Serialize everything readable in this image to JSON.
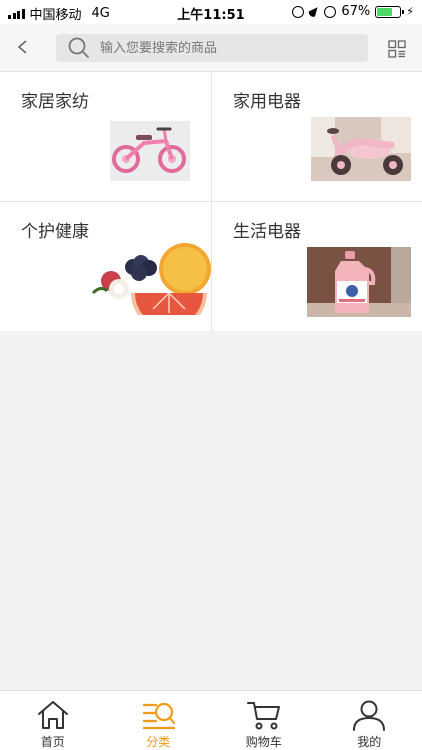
{
  "status_bar": {
    "carrier": "中国移动",
    "network": "4G",
    "time": "上午11:51",
    "battery": "67%",
    "battery_level": 0.67
  },
  "search": {
    "placeholder": "输入您要搜索的商品"
  },
  "categories": [
    {
      "title": "家居家纺",
      "icon": "pink-balance-bike"
    },
    {
      "title": "家用电器",
      "icon": "pink-tricycle"
    },
    {
      "title": "个护健康",
      "icon": "fruits-grapefruit-lychee"
    },
    {
      "title": "生活电器",
      "icon": "pink-detergent-bottle"
    }
  ],
  "tabs": [
    {
      "label": "首页",
      "icon": "home-icon",
      "active": false
    },
    {
      "label": "分类",
      "icon": "category-icon",
      "active": true
    },
    {
      "label": "购物车",
      "icon": "cart-icon",
      "active": false
    },
    {
      "label": "我的",
      "icon": "profile-icon",
      "active": false
    }
  ],
  "colors": {
    "accent": "#f09a1a",
    "background": "#f2f2f2"
  }
}
